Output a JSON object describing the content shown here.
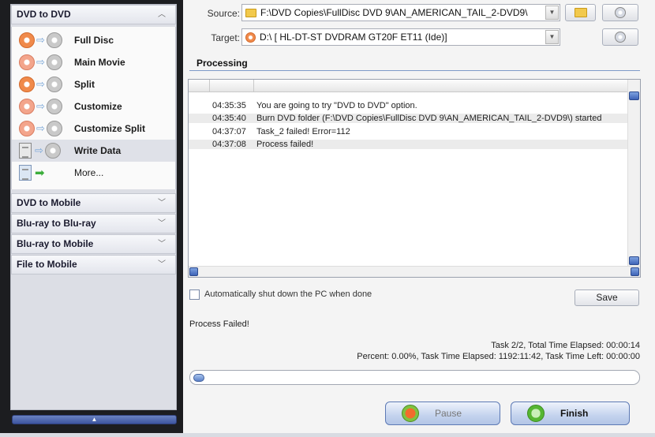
{
  "sidebar": {
    "sections": [
      {
        "label": "DVD to DVD",
        "expanded": true
      },
      {
        "label": "DVD to Mobile",
        "expanded": false
      },
      {
        "label": "Blu-ray to Blu-ray",
        "expanded": false
      },
      {
        "label": "Blu-ray to Mobile",
        "expanded": false
      },
      {
        "label": "File to Mobile",
        "expanded": false
      }
    ],
    "items": [
      {
        "label": "Full Disc",
        "icon": "disc-icon"
      },
      {
        "label": "Main Movie",
        "icon": "disc-icon"
      },
      {
        "label": "Split",
        "icon": "disc-icon"
      },
      {
        "label": "Customize",
        "icon": "disc-icon"
      },
      {
        "label": "Customize Split",
        "icon": "disc-icon"
      },
      {
        "label": "Write Data",
        "icon": "document-icon",
        "selected": true
      },
      {
        "label": "More...",
        "icon": "list-icon"
      }
    ]
  },
  "source": {
    "label": "Source:",
    "value": "F:\\DVD Copies\\FullDisc DVD 9\\AN_AMERICAN_TAIL_2-DVD9\\"
  },
  "target": {
    "label": "Target:",
    "value": "D:\\ [ HL-DT-ST DVDRAM GT20F ET11 (Ide)]"
  },
  "processing": {
    "title": "Processing",
    "log": [
      {
        "time": "04:35:35",
        "message": "You are going to try \"DVD to DVD\" option."
      },
      {
        "time": "04:35:40",
        "message": "Burn DVD folder (F:\\DVD Copies\\FullDisc DVD 9\\AN_AMERICAN_TAIL_2-DVD9\\) started"
      },
      {
        "time": "04:37:07",
        "message": "Task_2 failed! Error=112"
      },
      {
        "time": "04:37:08",
        "message": "Process failed!"
      }
    ]
  },
  "options": {
    "auto_shutdown_label": "Automatically shut down the PC when done",
    "save_label": "Save"
  },
  "status": {
    "message": "Process Failed!",
    "line1": "Task 2/2,  Total Time Elapsed: 00:00:14",
    "line2": "Percent: 0.00%,  Task Time Elapsed: 1192:11:42,  Task Time Left: 00:00:00",
    "progress_percent": 0.0
  },
  "buttons": {
    "pause_label": "Pause",
    "finish_label": "Finish"
  }
}
